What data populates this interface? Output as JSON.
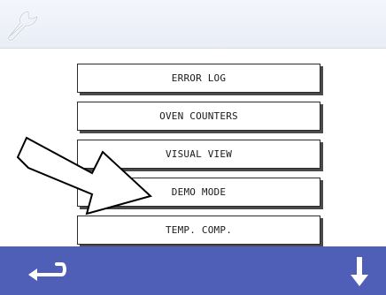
{
  "header": {
    "icon": "wrench-icon"
  },
  "menu": {
    "items": [
      {
        "label": "ERROR LOG"
      },
      {
        "label": "OVEN COUNTERS"
      },
      {
        "label": "VISUAL VIEW"
      },
      {
        "label": "DEMO MODE"
      },
      {
        "label": "TEMP. COMP."
      }
    ]
  },
  "footer": {
    "back_icon": "back-arrow-icon",
    "down_icon": "down-arrow-icon"
  },
  "overlay": {
    "icon": "pointer-arrow-icon"
  },
  "colors": {
    "footer_bg": "#4f5fb7",
    "header_bg": "#eef1f8"
  }
}
